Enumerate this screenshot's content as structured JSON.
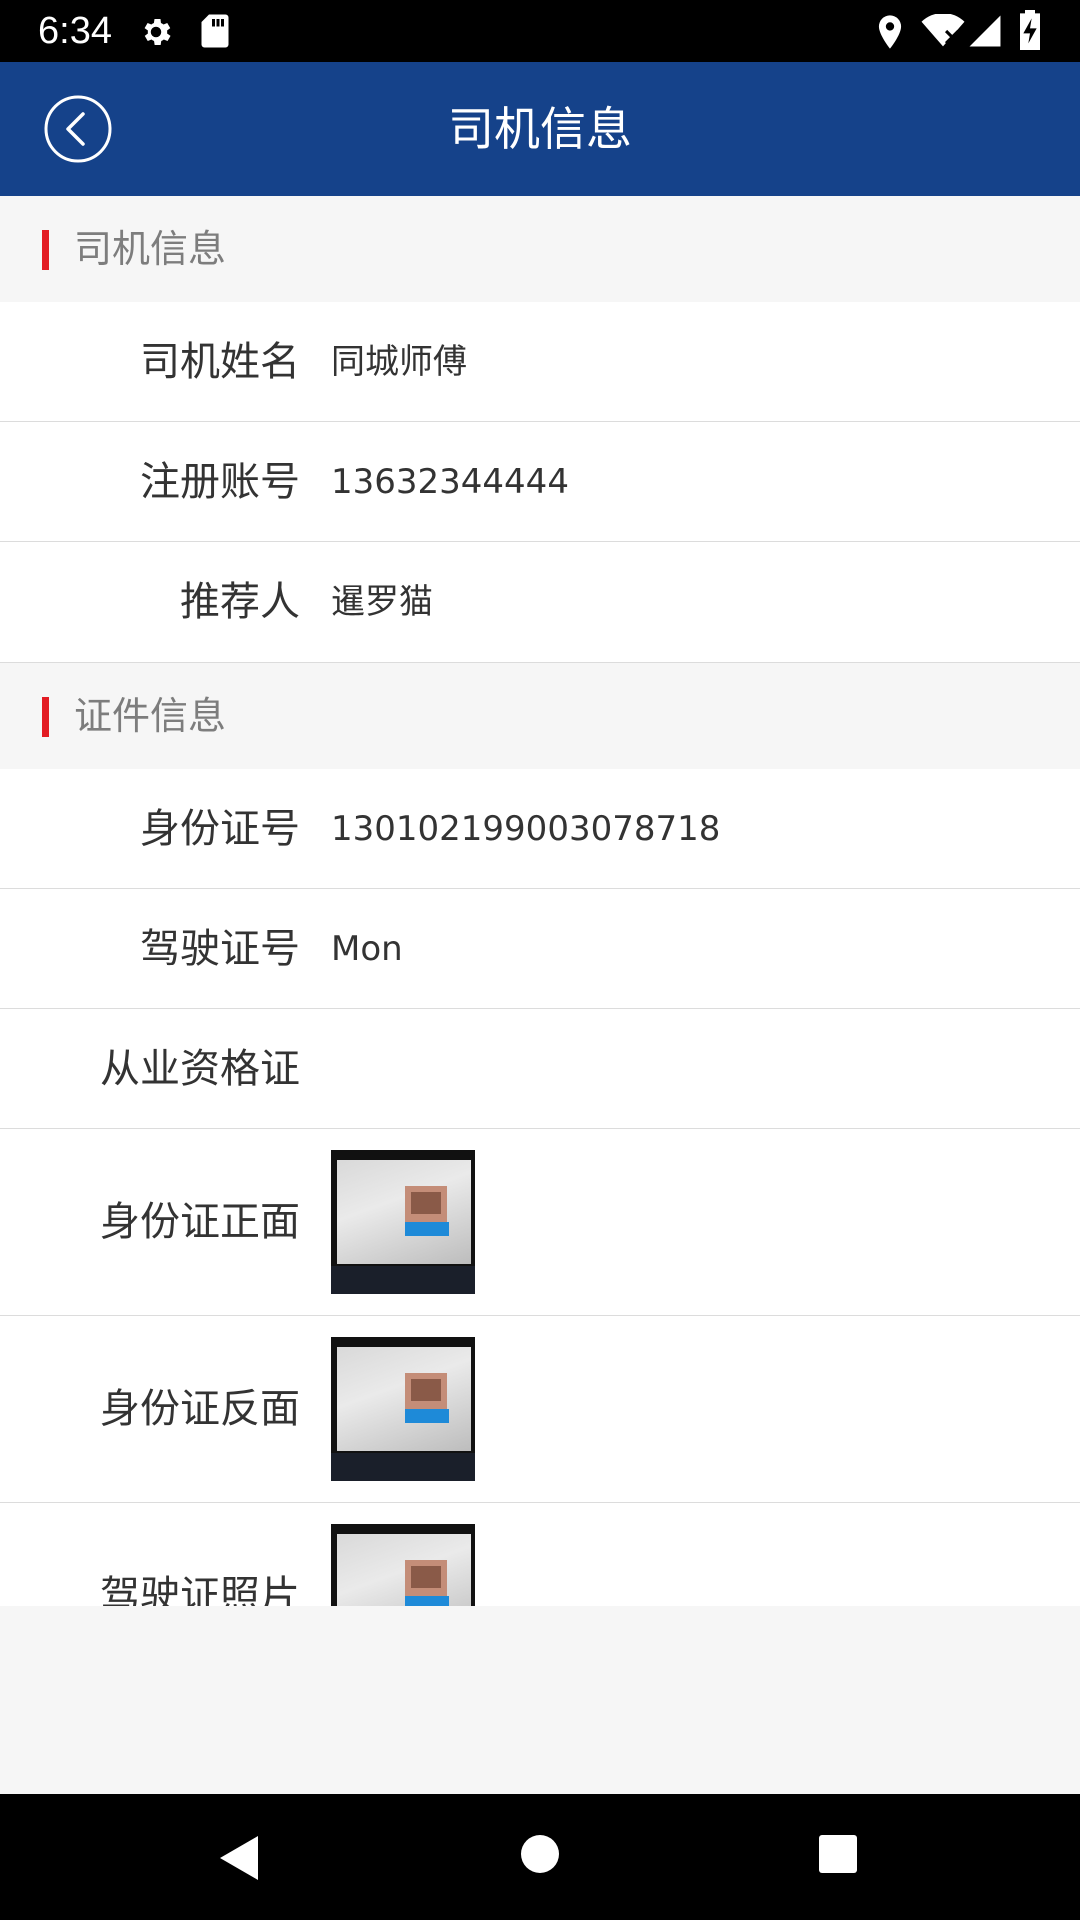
{
  "status_bar": {
    "time": "6:34",
    "left_icons": [
      "gear-icon",
      "sd-card-icon"
    ],
    "right_icons": [
      "location-icon",
      "wifi-off-icon",
      "signal-icon",
      "battery-charging-icon"
    ]
  },
  "app_bar": {
    "title": "司机信息",
    "back_icon": "chevron-left-icon",
    "background": "#15428a"
  },
  "sections": {
    "driver": {
      "title": "司机信息",
      "name_label": "司机姓名",
      "name_value": "同城师傅",
      "account_label": "注册账号",
      "account_value": "13632344444",
      "referrer_label": "推荐人",
      "referrer_value": "暹罗猫"
    },
    "license": {
      "title": "证件信息",
      "id_number_label": "身份证号",
      "id_number_value": "130102199003078718",
      "driver_license_label": "驾驶证号",
      "driver_license_value": "Mon",
      "qualification_label": "从业资格证",
      "qualification_value": "",
      "id_front_label": "身份证正面",
      "id_back_label": "身份证反面",
      "license_photo_label": "驾驶证照片"
    }
  },
  "accent_color": "#e31c23",
  "nav_bar": [
    "back-triangle-icon",
    "home-circle-icon",
    "recents-square-icon"
  ]
}
